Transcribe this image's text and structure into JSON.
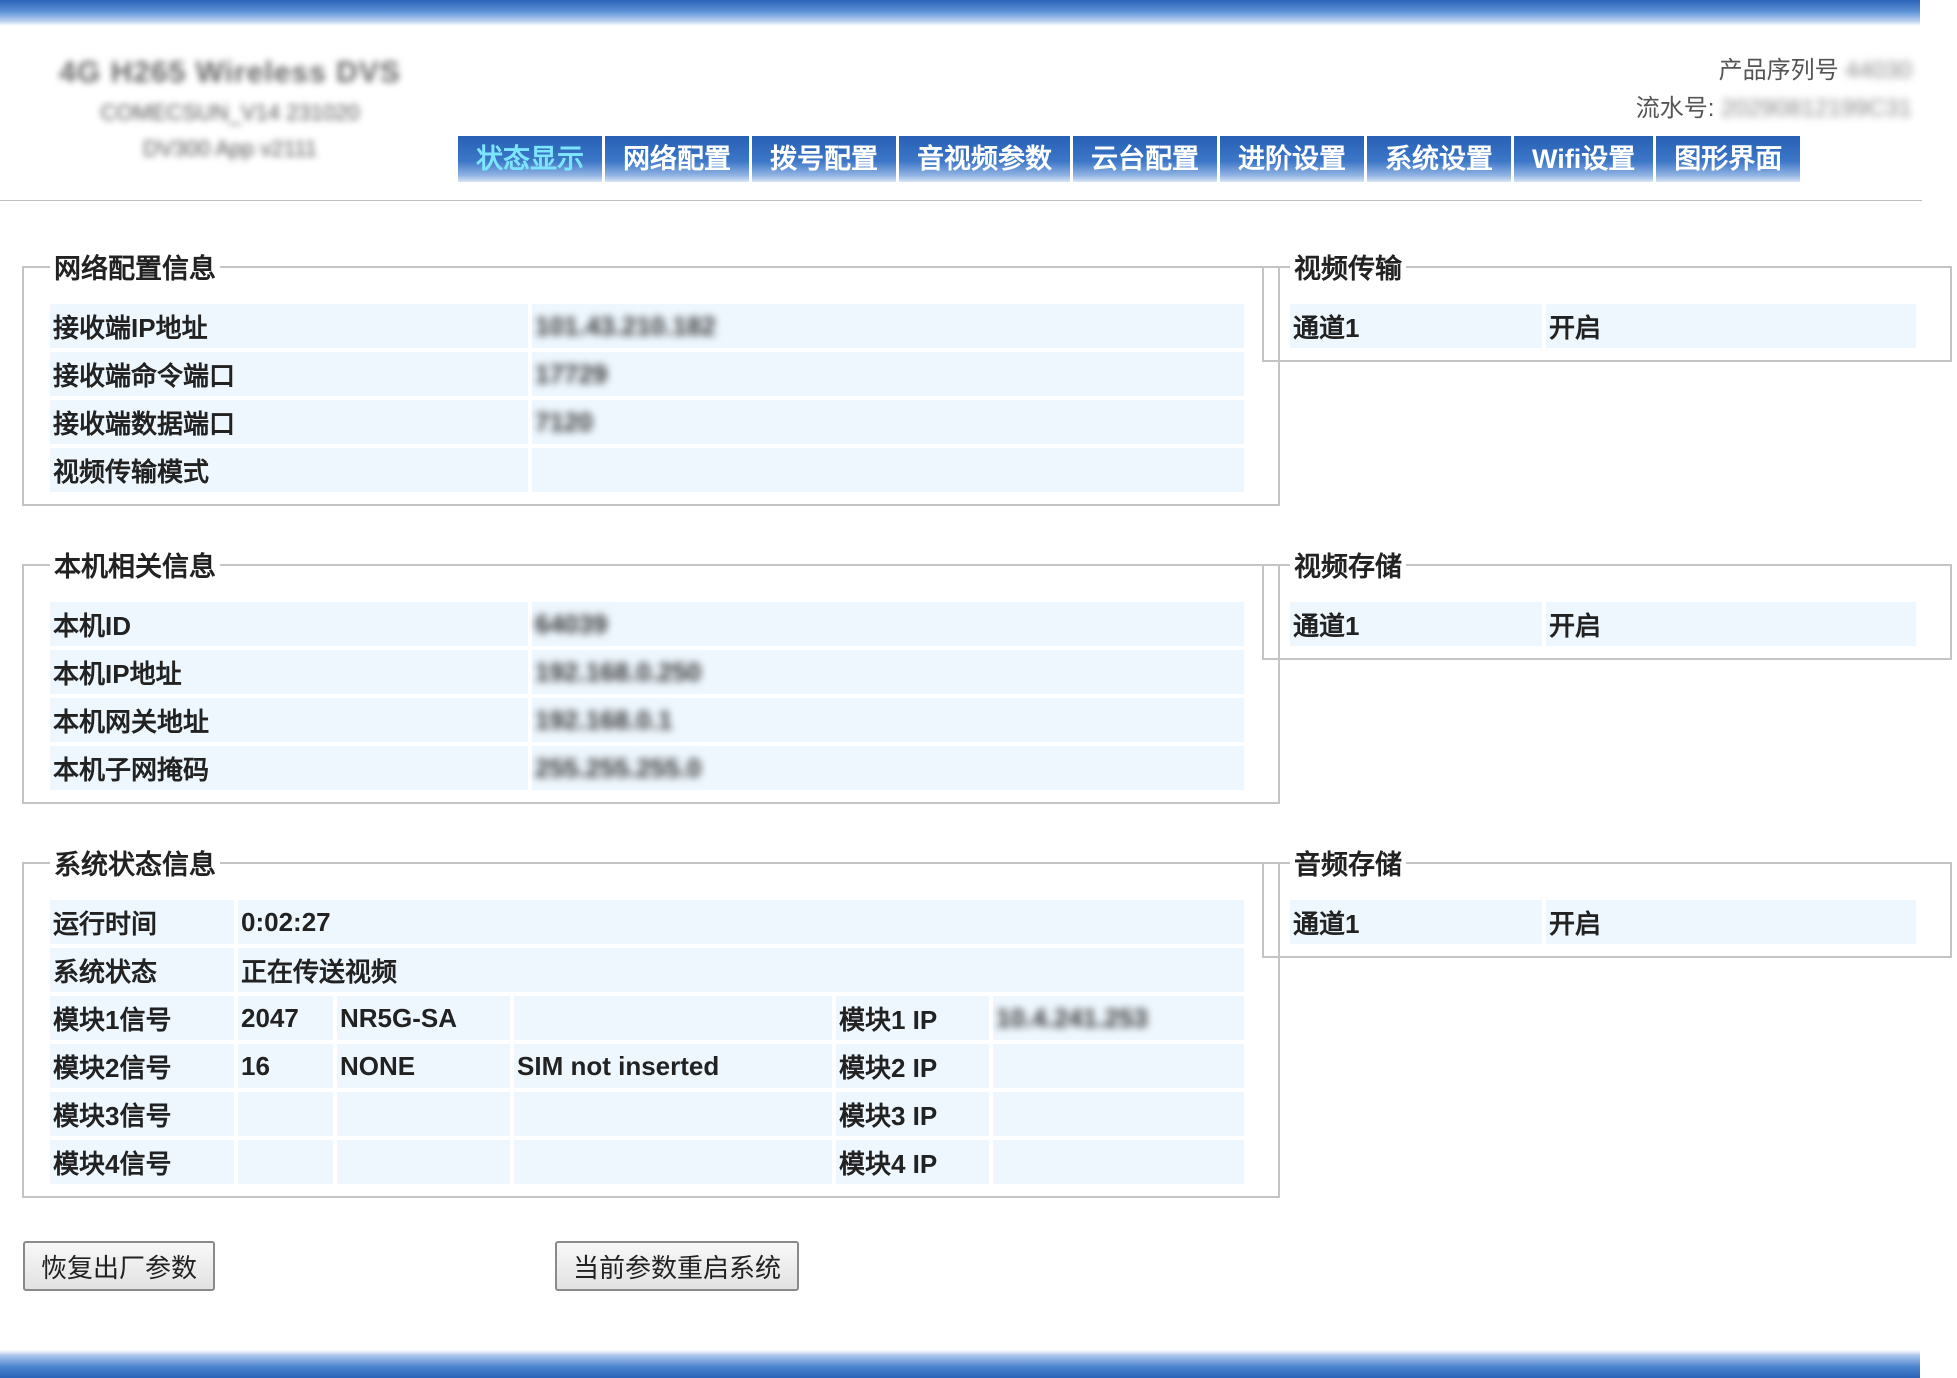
{
  "header": {
    "brand_line1": "4G H265 Wireless DVS",
    "brand_line2": "COMECSUN_V14 231020",
    "brand_line3": "DV300 App v2111",
    "serial_label": "产品序列号",
    "serial_value": "44030",
    "flow_label": "流水号:",
    "flow_value": "20290812199C31"
  },
  "nav": {
    "tabs": [
      "状态显示",
      "网络配置",
      "拨号配置",
      "音视频参数",
      "云台配置",
      "进阶设置",
      "系统设置",
      "Wifi设置",
      "图形界面"
    ]
  },
  "network": {
    "legend": "网络配置信息",
    "rows": [
      {
        "label": "接收端IP地址",
        "value": "101.43.210.182"
      },
      {
        "label": "接收端命令端口",
        "value": "17729"
      },
      {
        "label": "接收端数据端口",
        "value": "7120"
      },
      {
        "label": "视频传输模式",
        "value": ""
      }
    ]
  },
  "local": {
    "legend": "本机相关信息",
    "rows": [
      {
        "label": "本机ID",
        "value": "64039"
      },
      {
        "label": "本机IP地址",
        "value": "192.168.0.250"
      },
      {
        "label": "本机网关地址",
        "value": "192.168.0.1"
      },
      {
        "label": "本机子网掩码",
        "value": "255.255.255.0"
      }
    ]
  },
  "system": {
    "legend": "系统状态信息",
    "runtime_label": "运行时间",
    "runtime_value": "0:02:27",
    "status_label": "系统状态",
    "status_value": "正在传送视频",
    "modules": [
      {
        "label": "模块1信号",
        "signal": "2047",
        "net": "NR5G-SA",
        "sim": "",
        "ip_label": "模块1 IP",
        "ip": "10.4.241.253"
      },
      {
        "label": "模块2信号",
        "signal": "16",
        "net": "NONE",
        "sim": "SIM not inserted",
        "ip_label": "模块2 IP",
        "ip": ""
      },
      {
        "label": "模块3信号",
        "signal": "",
        "net": "",
        "sim": "",
        "ip_label": "模块3 IP",
        "ip": ""
      },
      {
        "label": "模块4信号",
        "signal": "",
        "net": "",
        "sim": "",
        "ip_label": "模块4 IP",
        "ip": ""
      }
    ]
  },
  "video_transfer": {
    "legend": "视频传输",
    "channel": "通道1",
    "state": "开启"
  },
  "video_storage": {
    "legend": "视频存储",
    "channel": "通道1",
    "state": "开启"
  },
  "audio_storage": {
    "legend": "音频存储",
    "channel": "通道1",
    "state": "开启"
  },
  "buttons": {
    "factory_reset": "恢复出厂参数",
    "restart": "当前参数重启系统"
  }
}
